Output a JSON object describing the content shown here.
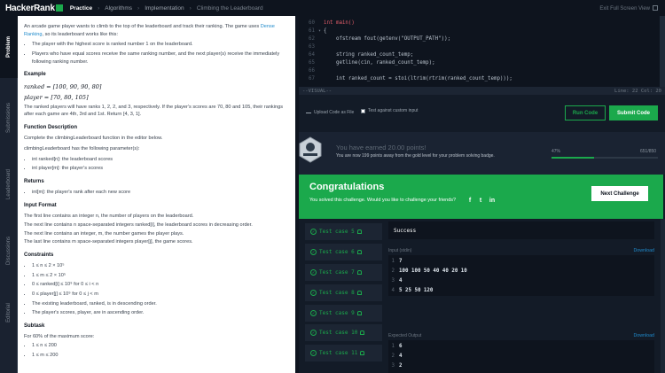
{
  "header": {
    "logo": "HackerRank",
    "crumbs": [
      "Practice",
      "Algorithms",
      "Implementation",
      "Climbing the Leaderboard"
    ],
    "exit_label": "Exit Full Screen View"
  },
  "tabs": [
    "Problem",
    "Submissions",
    "Leaderboard",
    "Discussions",
    "Editorial"
  ],
  "problem": {
    "intro": "An arcade game player wants to climb to the top of the leaderboard and track their ranking. The game uses",
    "intro_link": "Dense Ranking",
    "intro_end": ", so its leaderboard works like this:",
    "rules": [
      "The player with the highest score is ranked number 1 on the leaderboard.",
      "Players who have equal scores receive the same ranking number, and the next player(s) receive the immediately following ranking number."
    ],
    "example_heading": "Example",
    "example_ranked": "ranked = [100, 90, 90, 80]",
    "example_player": "player = [70, 80, 105]",
    "example_text": "The ranked players will have ranks 1, 2, 2, and 3, respectively. If the player's scores are 70, 80 and 105, their rankings after each game are 4th, 3rd and 1st. Return [4, 3, 1].",
    "function_heading": "Function Description",
    "function_text": "Complete the climbingLeaderboard function in the editor below.",
    "params_intro": "climbingLeaderboard has the following parameter(s):",
    "params": [
      "int ranked[n]: the leaderboard scores",
      "int player[m]: the player's scores"
    ],
    "returns_heading": "Returns",
    "returns": [
      "int[m]: the player's rank after each new score"
    ],
    "input_heading": "Input Format",
    "input_lines": [
      "The first line contains an integer n, the number of players on the leaderboard.",
      "The next line contains n space-separated integers ranked[i], the leaderboard scores in decreasing order.",
      "The next line contains an integer, m, the number games the player plays.",
      "The last line contains m space-separated integers player[j], the game scores."
    ],
    "constraints_heading": "Constraints",
    "constraints": [
      "1 ≤ n ≤ 2 × 10⁵",
      "1 ≤ m ≤ 2 × 10⁵",
      "0 ≤ ranked[i] ≤ 10⁹ for 0 ≤ i < n",
      "0 ≤ player[j] ≤ 10⁹ for 0 ≤ j < m",
      "The existing leaderboard, ranked, is in descending order.",
      "The player's scores, player, are in ascending order."
    ],
    "subtask_heading": "Subtask",
    "subtask_text": "For 60% of the maximum score:",
    "subtask_items": [
      "1 ≤ n ≤ 200",
      "1 ≤ m ≤ 200"
    ]
  },
  "editor": {
    "lines": [
      {
        "n": "60",
        "t": "int main()"
      },
      {
        "n": "61",
        "t": "{"
      },
      {
        "n": "62",
        "t": "    ofstream fout(getenv(\"OUTPUT_PATH\"));"
      },
      {
        "n": "63",
        "t": ""
      },
      {
        "n": "64",
        "t": "    string ranked_count_temp;"
      },
      {
        "n": "65",
        "t": "    getline(cin, ranked_count_temp);"
      },
      {
        "n": "66",
        "t": ""
      },
      {
        "n": "67",
        "t": "    int ranked_count = stoi(ltrim(rtrim(ranked_count_temp)));"
      },
      {
        "n": "68",
        "t": ""
      },
      {
        "n": "69",
        "t": "    string ranked_temp_temp;"
      }
    ],
    "mode": "--VISUAL--",
    "position": "Line: 22 Col: 20"
  },
  "actions": {
    "upload": "Upload Code as File",
    "custom": "Test against custom input",
    "run": "Run Code",
    "submit": "Submit Code"
  },
  "points": {
    "badge_label": "Problem Solving",
    "title": "You have earned 20.00 points!",
    "subtitle": "You are now 199 points away from the gold level for your problem solving badge.",
    "pct": "47%",
    "total": "651/850"
  },
  "congrats": {
    "title": "Congratulations",
    "subtitle": "You solved this challenge. Would you like to challenge your friends?",
    "next": "Next Challenge"
  },
  "tests": [
    "Test case 5",
    "Test case 6",
    "Test case 7",
    "Test case 8",
    "Test case 9",
    "Test case 10",
    "Test case 11"
  ],
  "result": {
    "status": "Success",
    "input_label": "Input (stdin)",
    "download": "Download",
    "input": [
      {
        "n": "1",
        "v": "7"
      },
      {
        "n": "2",
        "v": "100 100 50 40 40 20 10"
      },
      {
        "n": "3",
        "v": "4"
      },
      {
        "n": "4",
        "v": "5 25 50 120"
      }
    ],
    "output_label": "Expected Output",
    "output": [
      {
        "n": "1",
        "v": "6"
      },
      {
        "n": "2",
        "v": "4"
      },
      {
        "n": "3",
        "v": "2"
      },
      {
        "n": "4",
        "v": "1"
      }
    ]
  },
  "colors": {
    "accent": "#1ba94c",
    "link": "#1f8acb",
    "bg": "#0e141e"
  }
}
